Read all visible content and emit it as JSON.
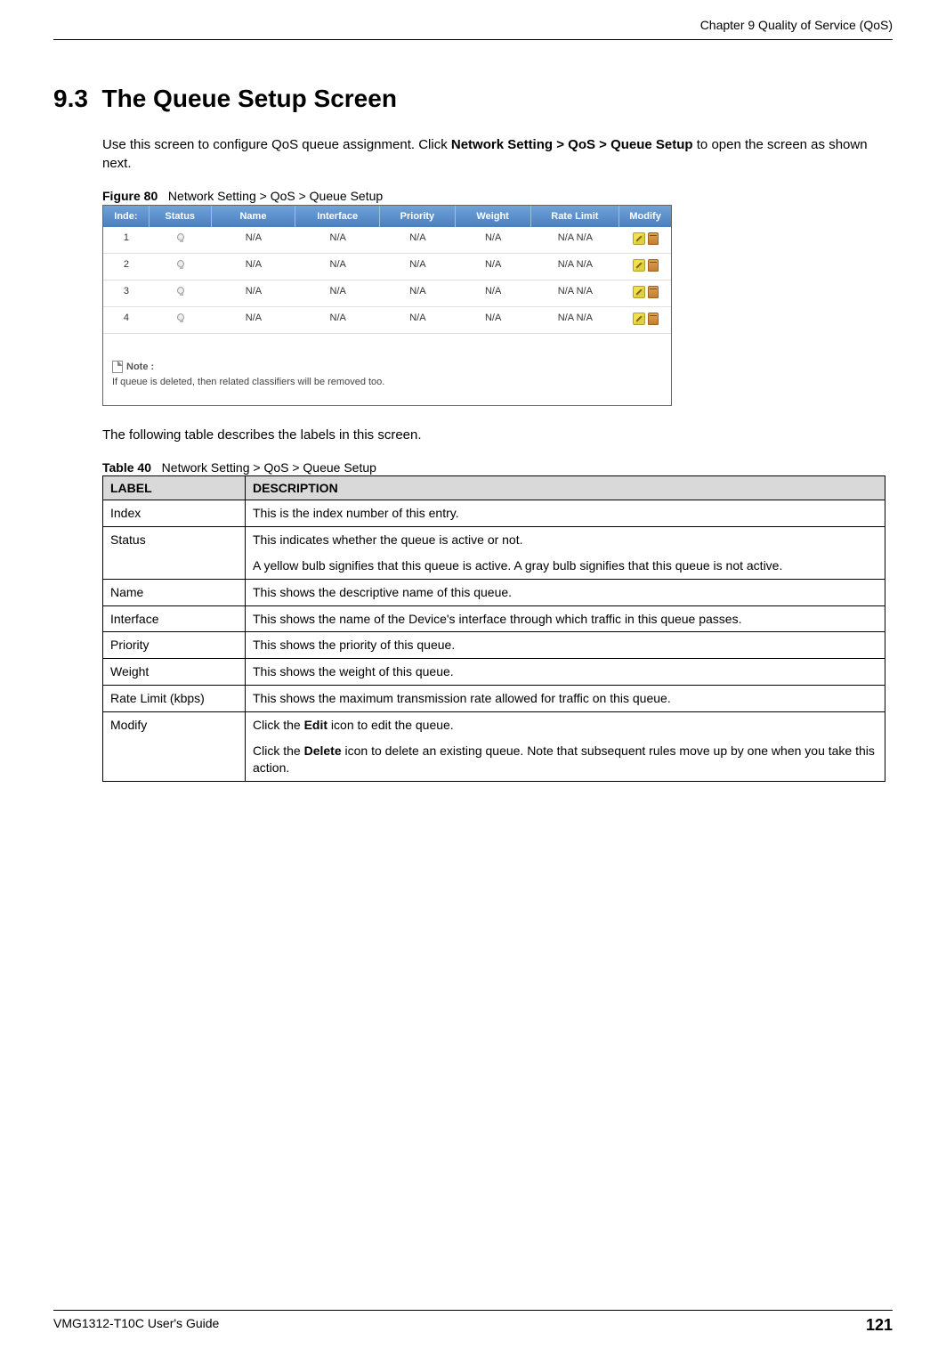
{
  "header": {
    "chapter": "Chapter 9 Quality of Service (QoS)"
  },
  "section": {
    "number": "9.3",
    "title": "The Queue Setup Screen"
  },
  "intro_text_1": "Use this screen to configure QoS queue assignment. Click ",
  "intro_bold": "Network Setting > QoS > Queue Setup",
  "intro_text_2": " to open the screen as shown next.",
  "figure": {
    "label": "Figure 80",
    "caption": "Network Setting > QoS > Queue Setup"
  },
  "screenshot": {
    "headers": {
      "index": "Inde:",
      "status": "Status",
      "name": "Name",
      "interface": "Interface",
      "priority": "Priority",
      "weight": "Weight",
      "rate": "Rate Limit",
      "modify": "Modify"
    },
    "rows": [
      {
        "index": "1",
        "name": "N/A",
        "interface": "N/A",
        "priority": "N/A",
        "weight": "N/A",
        "rate": "N/A N/A"
      },
      {
        "index": "2",
        "name": "N/A",
        "interface": "N/A",
        "priority": "N/A",
        "weight": "N/A",
        "rate": "N/A N/A"
      },
      {
        "index": "3",
        "name": "N/A",
        "interface": "N/A",
        "priority": "N/A",
        "weight": "N/A",
        "rate": "N/A N/A"
      },
      {
        "index": "4",
        "name": "N/A",
        "interface": "N/A",
        "priority": "N/A",
        "weight": "N/A",
        "rate": "N/A N/A"
      }
    ],
    "note_label": "Note :",
    "note_text": "If queue is deleted, then related classifiers will be removed too."
  },
  "mid_text": "The following table describes the labels in this screen.",
  "table": {
    "label": "Table 40",
    "caption": "Network Setting > QoS > Queue Setup",
    "header_label": "LABEL",
    "header_desc": "DESCRIPTION",
    "rows": [
      {
        "label": "Index",
        "desc": [
          "This is the index number of this entry."
        ]
      },
      {
        "label": "Status",
        "desc": [
          "This indicates whether the queue is active or not.",
          "A yellow bulb signifies that this queue is active. A gray bulb signifies that this queue is not active."
        ]
      },
      {
        "label": "Name",
        "desc": [
          "This shows the descriptive name of this queue."
        ]
      },
      {
        "label": "Interface",
        "desc": [
          "This shows the name of the Device's interface through which traffic in this queue passes."
        ]
      },
      {
        "label": "Priority",
        "desc": [
          "This shows the priority of this queue."
        ]
      },
      {
        "label": "Weight",
        "desc": [
          "This shows the weight of this queue."
        ]
      },
      {
        "label": "Rate Limit (kbps)",
        "desc": [
          "This shows the maximum transmission rate allowed for traffic on this queue."
        ]
      },
      {
        "label": "Modify",
        "desc_html": "modify"
      }
    ],
    "modify_p1_a": "Click the ",
    "modify_p1_b": "Edit",
    "modify_p1_c": " icon to edit the queue.",
    "modify_p2_a": "Click the ",
    "modify_p2_b": "Delete",
    "modify_p2_c": " icon to delete an existing queue. Note that subsequent rules move up by one when you take this action."
  },
  "footer": {
    "guide": "VMG1312-T10C User's Guide",
    "page": "121"
  }
}
